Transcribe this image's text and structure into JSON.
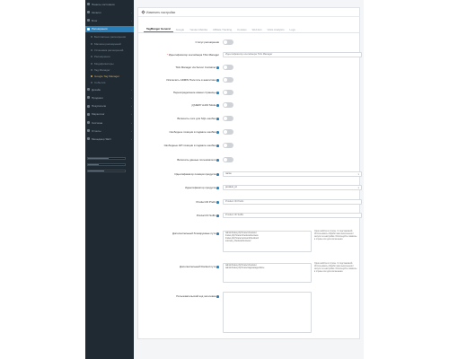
{
  "sidebar": {
    "items": [
      {
        "label": "Панель состояния",
        "chevron": false,
        "active": false,
        "sub": false
      },
      {
        "label": "Каталог",
        "chevron": true,
        "active": false,
        "sub": false
      },
      {
        "label": "Блог",
        "chevron": true,
        "active": false,
        "sub": false
      },
      {
        "label": "Расширения",
        "chevron": true,
        "active": true,
        "sub": false
      },
      {
        "label": "Бесплатные расширения",
        "chevron": false,
        "active": false,
        "sub": true,
        "on": false
      },
      {
        "label": "Магазин расширений",
        "chevron": false,
        "active": false,
        "sub": true,
        "on": false
      },
      {
        "label": "Установка расширений",
        "chevron": false,
        "active": false,
        "sub": true,
        "on": false
      },
      {
        "label": "Расширения",
        "chevron": false,
        "active": false,
        "sub": true,
        "on": false
      },
      {
        "label": "Модификаторы",
        "chevron": false,
        "active": false,
        "sub": true,
        "on": false
      },
      {
        "label": "Tag Manager",
        "chevron": false,
        "active": false,
        "sub": true,
        "on": false
      },
      {
        "label": "Google Tag Manager",
        "chevron": false,
        "active": false,
        "sub": true,
        "on": true
      },
      {
        "label": "События",
        "chevron": false,
        "active": false,
        "sub": true,
        "on": false
      },
      {
        "label": "Дизайн",
        "chevron": true,
        "active": false,
        "sub": false
      },
      {
        "label": "Продажи",
        "chevron": true,
        "active": false,
        "sub": false
      },
      {
        "label": "Покупатели",
        "chevron": true,
        "active": false,
        "sub": false
      },
      {
        "label": "Маркетинг",
        "chevron": true,
        "active": false,
        "sub": false
      },
      {
        "label": "Система",
        "chevron": true,
        "active": false,
        "sub": false
      },
      {
        "label": "Отчеты",
        "chevron": true,
        "active": false,
        "sub": false
      },
      {
        "label": "Менеджер SEO",
        "chevron": true,
        "active": false,
        "sub": false
      }
    ],
    "bars": [
      0.55,
      0.3,
      0.45
    ]
  },
  "panel": {
    "title": "Изменить настройки"
  },
  "tabs": [
    {
      "label": "TagManger General",
      "active": true
    },
    {
      "label": "Google",
      "active": false
    },
    {
      "label": "Yandex Metrika",
      "active": false
    },
    {
      "label": "Affiliate Tracking",
      "active": false
    },
    {
      "label": "Cookies",
      "active": false
    },
    {
      "label": "Web Ext",
      "active": false
    },
    {
      "label": "Visits Analytics",
      "active": false
    },
    {
      "label": "Logs",
      "active": false
    }
  ],
  "form": {
    "status_label": "Статус расширения",
    "container_label": "Идентификатор контейнера TAG Manager",
    "container_placeholder": "Идентификатор контейнера TAG Manager",
    "server_label": "TAG Manager via Server Container",
    "admin_label": "Исключить ADMIN Посетить в аналитике",
    "prev_page_label": "Переопределение имени страницы",
    "ajax_label": "jQUERY AJAX Mode",
    "sql_label": "Включить логи для SQL ошибок",
    "footer_label": "Свободное позиции в подвале ошибки",
    "api_label": "Свободные API позиции в подвале ошибки",
    "pro_label": "Включить данные пользователя",
    "product_id_label": "Идентификатор позиции продукта",
    "product_id_value": "name",
    "product_id2_label": "Идентификатор продукта",
    "product_id2_value": "product_id",
    "prefix_label": "Product ID Prefix",
    "prefix_placeholder": "Product ID Prefix",
    "suffix_label": "Product ID Suffix",
    "suffix_placeholder": "Product ID Suffix",
    "extra_label": "Дополнительный блокируемые пути",
    "extra_value": "/admin/index.php?route=checkout\n/index.php?route=checkout/success\n/index.php?route=account/checkout/\nsuccess_checkout/success/",
    "extra_help": "Один шаблон в строке. С подстановкой. Использовать обработчики выполнения /запуск-тэг-настройки. Используйте символы в строке или для исключения.",
    "extra2_label": "Дополнительный blocked пути",
    "extra2_value": "/admin/index.php?route=checkout\n/admin/index.php?route=tagmanager/done",
    "extra2_help": "Один шаблон в строке. С подстановкой. Использовать обработчики выполнения /запуск-тэг-настройки. Используйте символы в строке или для исключения.",
    "custom_label": "Пользовательский код заголовка"
  }
}
